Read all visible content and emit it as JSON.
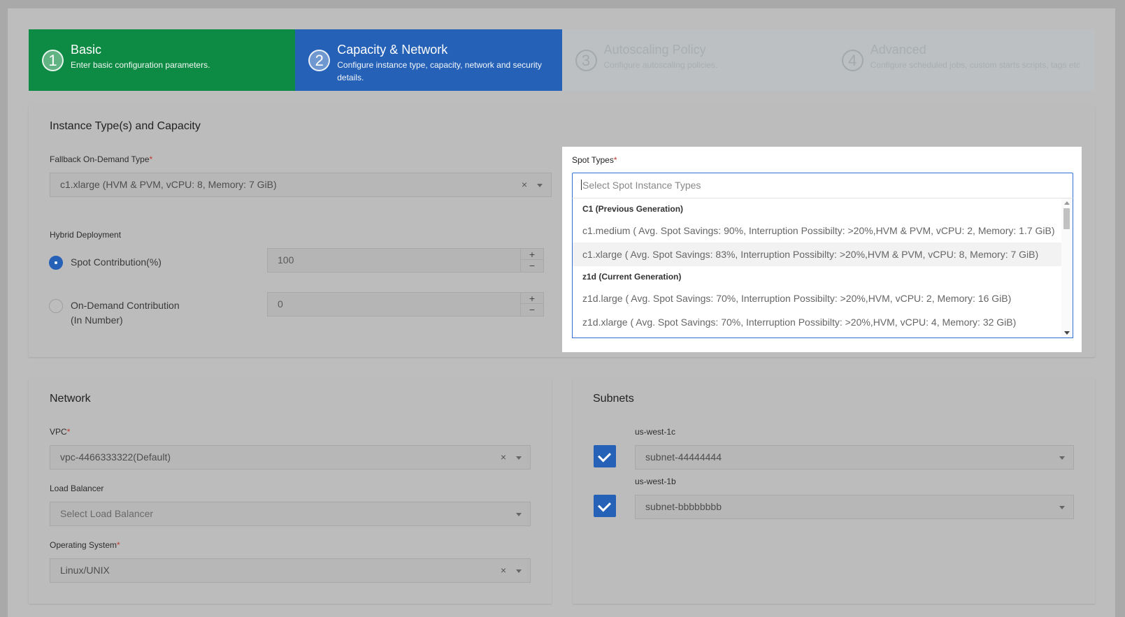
{
  "steps": [
    {
      "num": "1",
      "title": "Basic",
      "desc": "Enter basic configuration parameters."
    },
    {
      "num": "2",
      "title": "Capacity & Network",
      "desc": "Configure instance type, capacity, network and security details."
    },
    {
      "num": "3",
      "title": "Autoscaling Policy",
      "desc": "Configure autoscaling policies."
    },
    {
      "num": "4",
      "title": "Advanced",
      "desc": "Configure scheduled jobs, custom starts scripts, tags etc"
    }
  ],
  "capacity": {
    "title": "Instance Type(s) and Capacity",
    "fallback_label": "Fallback On-Demand Type",
    "fallback_value": "c1.xlarge (HVM & PVM, vCPU: 8, Memory: 7 GiB)",
    "hybrid_label": "Hybrid Deployment",
    "spot_contribution_label": "Spot Contribution(%)",
    "spot_contribution_value": "100",
    "ondemand_label_1": "On-Demand Contribution",
    "ondemand_label_2": "(In Number)",
    "ondemand_value": "0"
  },
  "spot": {
    "label": "Spot Types",
    "placeholder": "Select Spot Instance Types",
    "groups": [
      {
        "name": "C1 (Previous Generation)",
        "options": [
          "c1.medium ( Avg. Spot Savings: 90%, Interruption Possibilty: >20%,HVM & PVM, vCPU: 2, Memory: 1.7 GiB)",
          "c1.xlarge ( Avg. Spot Savings: 83%, Interruption Possibilty: >20%,HVM & PVM, vCPU: 8, Memory: 7 GiB)"
        ]
      },
      {
        "name": "z1d (Current Generation)",
        "options": [
          "z1d.large ( Avg. Spot Savings: 70%, Interruption Possibilty: >20%,HVM, vCPU: 2, Memory: 16 GiB)",
          "z1d.xlarge ( Avg. Spot Savings: 70%, Interruption Possibilty: >20%,HVM, vCPU: 4, Memory: 32 GiB)"
        ]
      }
    ]
  },
  "network": {
    "title": "Network",
    "vpc_label": "VPC",
    "vpc_value": "vpc-4466333322(Default)",
    "lb_label": "Load Balancer",
    "lb_placeholder": "Select Load Balancer",
    "os_label": "Operating System",
    "os_value": "Linux/UNIX"
  },
  "subnets": {
    "title": "Subnets",
    "items": [
      {
        "zone": "us-west-1c",
        "value": "subnet-44444444"
      },
      {
        "zone": "us-west-1b",
        "value": "subnet-bbbbbbbb"
      }
    ]
  },
  "required_mark": "*",
  "clear_glyph": "×"
}
